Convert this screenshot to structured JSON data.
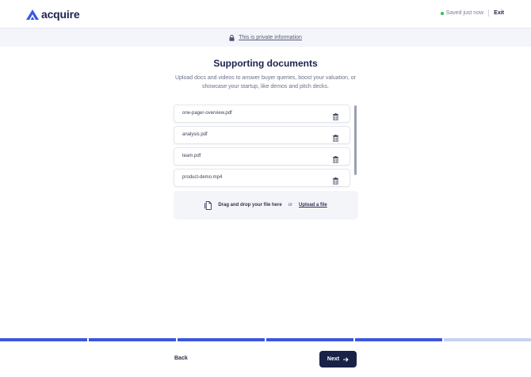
{
  "brand": {
    "name": "acquire",
    "color": "#3a57e8",
    "dark": "#1c2250"
  },
  "header": {
    "saved_text": "Saved just now",
    "saved_color": "#2bbf5a",
    "exit_label": "Exit"
  },
  "banner": {
    "icon": "lock-icon",
    "text": "This is private information"
  },
  "page": {
    "title": "Supporting documents",
    "subtitle": "Upload docs and videos to answer buyer queries, boost your valuation, or showcase your startup, like demos and pitch decks."
  },
  "files": [
    {
      "name": "one-pager-overview.pdf",
      "icon": "trash-icon"
    },
    {
      "name": "analysis.pdf",
      "icon": "trash-icon"
    },
    {
      "name": "team.pdf",
      "icon": "trash-icon"
    },
    {
      "name": "product-demo.mp4",
      "icon": "trash-icon"
    }
  ],
  "dropzone": {
    "icon": "file-upload-icon",
    "text": "Drag and drop your file here",
    "or": "or",
    "link": "Upload a file"
  },
  "progress": {
    "total_steps": 6,
    "completed_steps": 5,
    "done_color": "#3d55dd",
    "todo_color": "#c7d1f2"
  },
  "footer": {
    "back_label": "Back",
    "next_label": "Next",
    "next_icon": "arrow-right-icon"
  }
}
